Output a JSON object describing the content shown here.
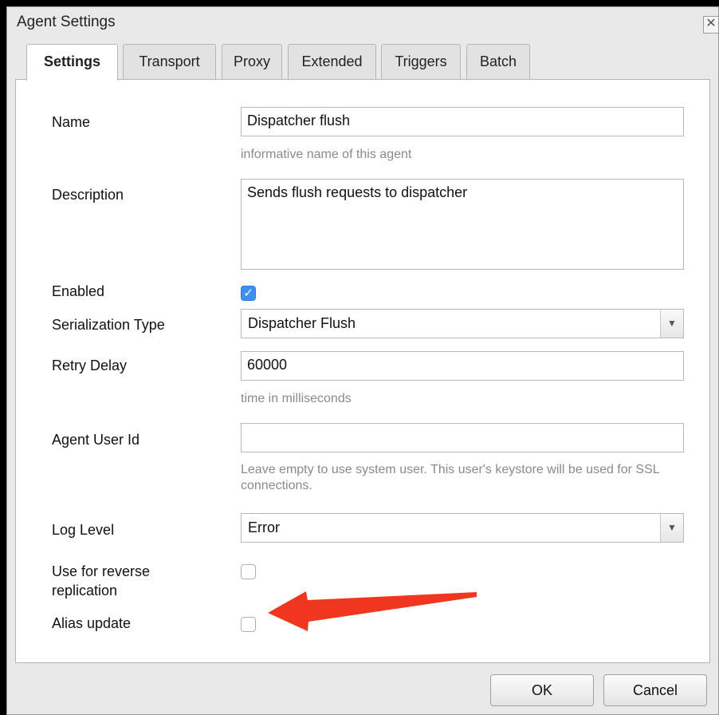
{
  "window": {
    "title": "Agent Settings",
    "close_symbol": "✕"
  },
  "tabs": [
    {
      "label": "Settings",
      "active": true
    },
    {
      "label": "Transport",
      "active": false
    },
    {
      "label": "Proxy",
      "active": false
    },
    {
      "label": "Extended",
      "active": false
    },
    {
      "label": "Triggers",
      "active": false
    },
    {
      "label": "Batch",
      "active": false
    }
  ],
  "form": {
    "name": {
      "label": "Name",
      "value": "Dispatcher flush",
      "hint": "informative name of this agent"
    },
    "description": {
      "label": "Description",
      "value": "Sends flush requests to dispatcher"
    },
    "enabled": {
      "label": "Enabled",
      "checked": true
    },
    "serialization_type": {
      "label": "Serialization Type",
      "value": "Dispatcher Flush"
    },
    "retry_delay": {
      "label": "Retry Delay",
      "value": "60000",
      "hint": "time in milliseconds"
    },
    "agent_user_id": {
      "label": "Agent User Id",
      "value": "",
      "hint": "Leave empty to use system user. This user's keystore will be used for SSL connections."
    },
    "log_level": {
      "label": "Log Level",
      "value": "Error"
    },
    "reverse_replication": {
      "label": "Use for reverse replication",
      "checked": false
    },
    "alias_update": {
      "label": "Alias update",
      "checked": false
    }
  },
  "buttons": {
    "ok": "OK",
    "cancel": "Cancel"
  },
  "colors": {
    "accent": "#3d8ff2",
    "annotation_arrow": "#f0361f"
  },
  "icons": {
    "dropdown": "chevron-down-icon",
    "check": "checkmark-icon",
    "close": "close-icon"
  }
}
